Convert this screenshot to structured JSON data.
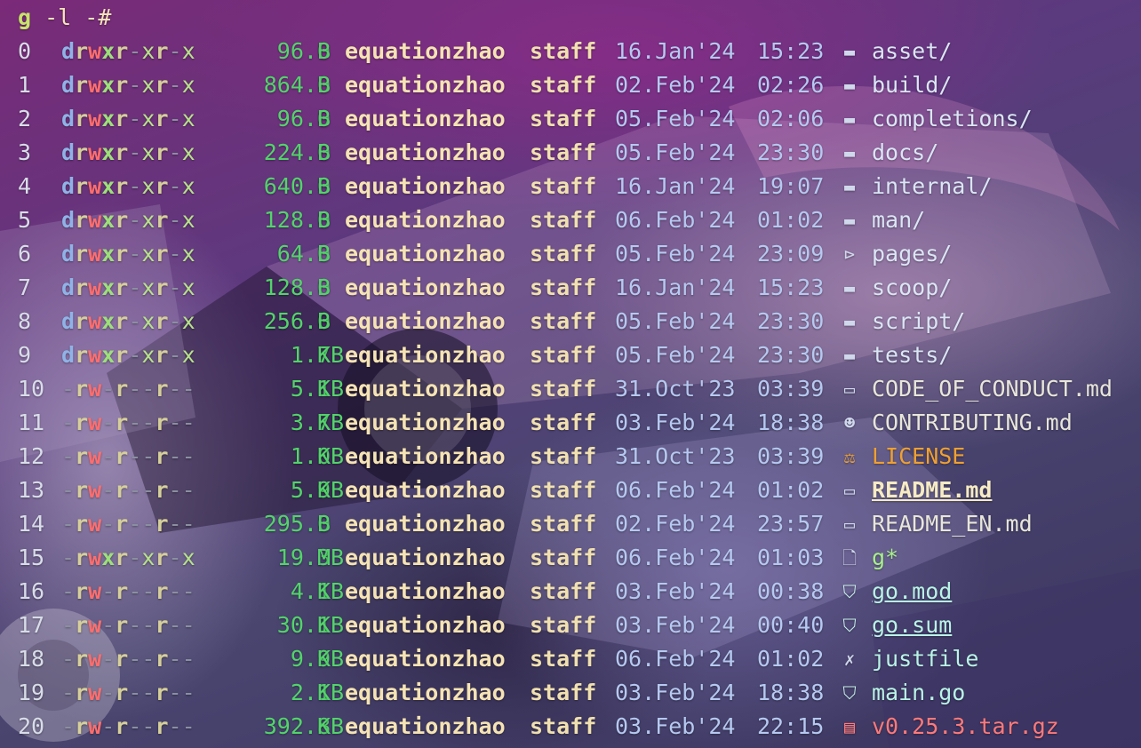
{
  "prompt": {
    "cmd": "g",
    "args": " -l -#"
  },
  "rows": [
    {
      "idx": "0",
      "perm": "drwxr-xr-x",
      "size": "96.0",
      "unit": "B",
      "owner": "equationzhao",
      "group": "staff",
      "date": "16.Jan'24",
      "time": "15:23",
      "icon": "folder-icon",
      "name": "asset/",
      "kind": "dir"
    },
    {
      "idx": "1",
      "perm": "drwxr-xr-x",
      "size": "864.0",
      "unit": "B",
      "owner": "equationzhao",
      "group": "staff",
      "date": "02.Feb'24",
      "time": "02:26",
      "icon": "folder-icon",
      "name": "build/",
      "kind": "dir"
    },
    {
      "idx": "2",
      "perm": "drwxr-xr-x",
      "size": "96.0",
      "unit": "B",
      "owner": "equationzhao",
      "group": "staff",
      "date": "05.Feb'24",
      "time": "02:06",
      "icon": "folder-icon",
      "name": "completions/",
      "kind": "dir"
    },
    {
      "idx": "3",
      "perm": "drwxr-xr-x",
      "size": "224.0",
      "unit": "B",
      "owner": "equationzhao",
      "group": "staff",
      "date": "05.Feb'24",
      "time": "23:30",
      "icon": "folder-icon",
      "name": "docs/",
      "kind": "dir"
    },
    {
      "idx": "4",
      "perm": "drwxr-xr-x",
      "size": "640.0",
      "unit": "B",
      "owner": "equationzhao",
      "group": "staff",
      "date": "16.Jan'24",
      "time": "19:07",
      "icon": "folder-icon",
      "name": "internal/",
      "kind": "dir"
    },
    {
      "idx": "5",
      "perm": "drwxr-xr-x",
      "size": "128.0",
      "unit": "B",
      "owner": "equationzhao",
      "group": "staff",
      "date": "06.Feb'24",
      "time": "01:02",
      "icon": "folder-icon",
      "name": "man/",
      "kind": "dir"
    },
    {
      "idx": "6",
      "perm": "drwxr-xr-x",
      "size": "64.0",
      "unit": "B",
      "owner": "equationzhao",
      "group": "staff",
      "date": "05.Feb'24",
      "time": "23:09",
      "icon": "folder-open-icon",
      "name": "pages/",
      "kind": "dir"
    },
    {
      "idx": "7",
      "perm": "drwxr-xr-x",
      "size": "128.0",
      "unit": "B",
      "owner": "equationzhao",
      "group": "staff",
      "date": "16.Jan'24",
      "time": "15:23",
      "icon": "folder-icon",
      "name": "scoop/",
      "kind": "dir"
    },
    {
      "idx": "8",
      "perm": "drwxr-xr-x",
      "size": "256.0",
      "unit": "B",
      "owner": "equationzhao",
      "group": "staff",
      "date": "05.Feb'24",
      "time": "23:30",
      "icon": "folder-icon",
      "name": "script/",
      "kind": "dir"
    },
    {
      "idx": "9",
      "perm": "drwxr-xr-x",
      "size": "1.7",
      "unit": "KB",
      "owner": "equationzhao",
      "group": "staff",
      "date": "05.Feb'24",
      "time": "23:30",
      "icon": "folder-icon",
      "name": "tests/",
      "kind": "dir"
    },
    {
      "idx": "10",
      "perm": "-rw-r--r--",
      "size": "5.1",
      "unit": "KB",
      "owner": "equationzhao",
      "group": "staff",
      "date": "31.Oct'23",
      "time": "03:39",
      "icon": "markdown-icon",
      "name": "CODE_OF_CONDUCT.md",
      "kind": "md"
    },
    {
      "idx": "11",
      "perm": "-rw-r--r--",
      "size": "3.7",
      "unit": "KB",
      "owner": "equationzhao",
      "group": "staff",
      "date": "03.Feb'24",
      "time": "18:38",
      "icon": "people-icon",
      "name": "CONTRIBUTING.md",
      "kind": "md"
    },
    {
      "idx": "12",
      "perm": "-rw-r--r--",
      "size": "1.0",
      "unit": "KB",
      "owner": "equationzhao",
      "group": "staff",
      "date": "31.Oct'23",
      "time": "03:39",
      "icon": "scale-icon",
      "name": "LICENSE",
      "kind": "lic"
    },
    {
      "idx": "13",
      "perm": "-rw-r--r--",
      "size": "5.9",
      "unit": "KB",
      "owner": "equationzhao",
      "group": "staff",
      "date": "06.Feb'24",
      "time": "01:02",
      "icon": "markdown-icon",
      "name": "README.md",
      "kind": "readme"
    },
    {
      "idx": "14",
      "perm": "-rw-r--r--",
      "size": "295.0",
      "unit": "B",
      "owner": "equationzhao",
      "group": "staff",
      "date": "02.Feb'24",
      "time": "23:57",
      "icon": "markdown-icon",
      "name": "README_EN.md",
      "kind": "md"
    },
    {
      "idx": "15",
      "perm": "-rwxr-xr-x",
      "size": "19.3",
      "unit": "MB",
      "owner": "equationzhao",
      "group": "staff",
      "date": "06.Feb'24",
      "time": "01:03",
      "icon": "file-icon",
      "name": "g*",
      "kind": "exe"
    },
    {
      "idx": "16",
      "perm": "-rw-r--r--",
      "size": "4.1",
      "unit": "KB",
      "owner": "equationzhao",
      "group": "staff",
      "date": "03.Feb'24",
      "time": "00:38",
      "icon": "gopher-icon",
      "name": "go.mod",
      "kind": "go"
    },
    {
      "idx": "17",
      "perm": "-rw-r--r--",
      "size": "30.1",
      "unit": "KB",
      "owner": "equationzhao",
      "group": "staff",
      "date": "03.Feb'24",
      "time": "00:40",
      "icon": "gopher-icon",
      "name": "go.sum",
      "kind": "go"
    },
    {
      "idx": "18",
      "perm": "-rw-r--r--",
      "size": "9.9",
      "unit": "KB",
      "owner": "equationzhao",
      "group": "staff",
      "date": "06.Feb'24",
      "time": "01:02",
      "icon": "tools-icon",
      "name": "justfile",
      "kind": "just"
    },
    {
      "idx": "19",
      "perm": "-rw-r--r--",
      "size": "2.1",
      "unit": "KB",
      "owner": "equationzhao",
      "group": "staff",
      "date": "03.Feb'24",
      "time": "18:38",
      "icon": "gopher-icon",
      "name": "main.go",
      "kind": "goplain"
    },
    {
      "idx": "20",
      "perm": "-rw-r--r--",
      "size": "392.8",
      "unit": "KB",
      "owner": "equationzhao",
      "group": "staff",
      "date": "03.Feb'24",
      "time": "22:15",
      "icon": "archive-icon",
      "name": "v0.25.3.tar.gz",
      "kind": "tar"
    }
  ]
}
